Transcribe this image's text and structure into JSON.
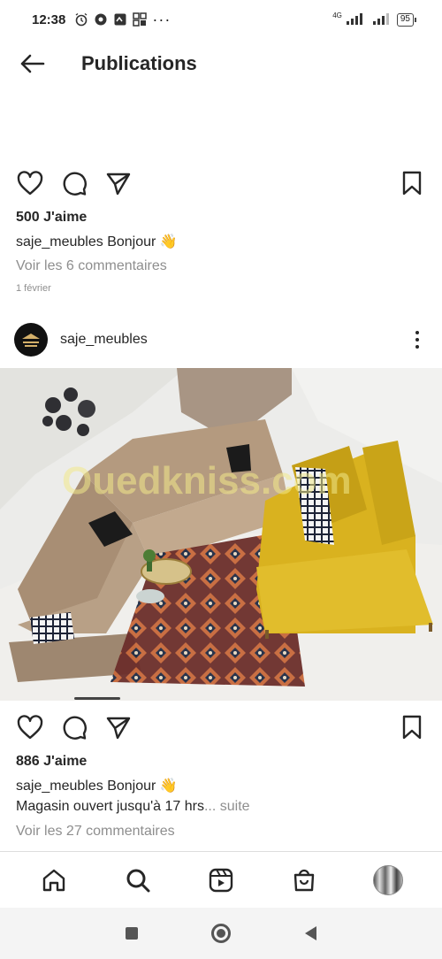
{
  "status_bar": {
    "time": "12:38",
    "battery": "95",
    "network": "4G"
  },
  "header": {
    "title": "Publications"
  },
  "post1": {
    "likes": "500 J'aime",
    "username": "saje_meubles",
    "caption": "Bonjour 👋",
    "comments": "Voir les 6 commentaires",
    "date": "1 février"
  },
  "post2": {
    "username": "saje_meubles",
    "image_watermark": "Ouedkniss.com",
    "likes": "886 J'aime",
    "caption_user": "saje_meubles",
    "caption": "Bonjour 👋",
    "caption_line2": "Magasin ouvert jusqu'à 17 hrs",
    "ellipsis": "...",
    "more_label": "suite",
    "comments": "Voir les 27 commentaires"
  },
  "bottom_nav": [
    "home-icon",
    "search-icon",
    "reels-icon",
    "shop-icon",
    "profile-avatar"
  ],
  "colors": {
    "text": "#262626",
    "secondary": "#8e8e8e",
    "sofa_beige": "#b49a7f",
    "armchair_yellow": "#d9b21f"
  }
}
